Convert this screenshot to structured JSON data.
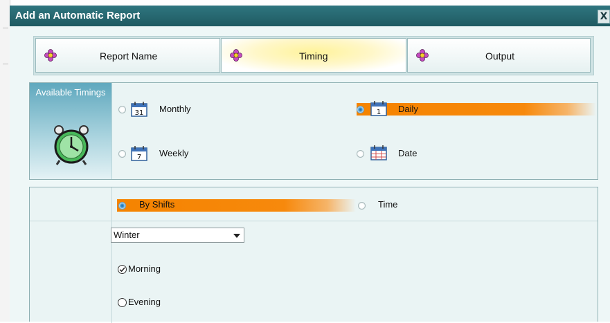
{
  "window": {
    "title": "Add an Automatic Report",
    "close_label": "X"
  },
  "tabs": [
    {
      "label": "Report Name",
      "icon": "flower-icon",
      "active": false
    },
    {
      "label": "Timing",
      "icon": "flower-icon",
      "active": true
    },
    {
      "label": "Output",
      "icon": "flower-icon",
      "active": false
    }
  ],
  "timings": {
    "side_label": "Available Timings",
    "options": [
      {
        "label": "Monthly",
        "icon_number": "31",
        "selected": false
      },
      {
        "label": "Daily",
        "icon_number": "1",
        "selected": true
      },
      {
        "label": "Weekly",
        "icon_number": "7",
        "selected": false
      },
      {
        "label": "Date",
        "icon_number": "",
        "selected": false
      }
    ]
  },
  "schedule": {
    "modes": [
      {
        "label": "By Shifts",
        "selected": true
      },
      {
        "label": "Time",
        "selected": false
      }
    ],
    "season": {
      "value": "Winter"
    },
    "shifts": [
      {
        "label": "Morning",
        "checked": true
      },
      {
        "label": "Evening",
        "checked": false
      }
    ]
  },
  "colors": {
    "titlebar": "#2f7680",
    "highlight": "#f58300",
    "panel": "#eaf4f4"
  }
}
